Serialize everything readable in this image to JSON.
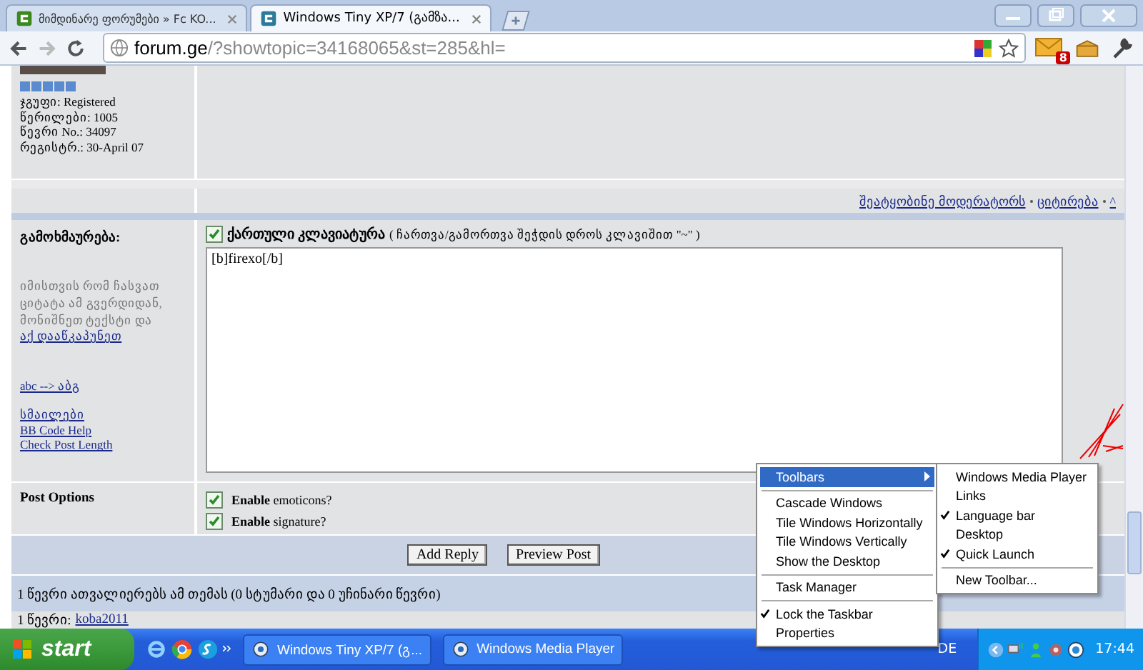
{
  "browser": {
    "tabs": [
      {
        "title": "მიმდინარე ფორუმები » Fc KO...",
        "selected": false
      },
      {
        "title": "Windows Tiny XP/7 (გამზა...",
        "selected": true
      }
    ],
    "address": {
      "host": "forum.ge",
      "path": "/?showtopic=34168065&st=285&hl="
    },
    "mail_count": "8"
  },
  "profile": {
    "lines": [
      "ჯგუფი: Registered",
      "წერილები: 1005",
      "წევრი No.: 34097",
      "რეგისტრ.: 30-April 07"
    ]
  },
  "post_links": [
    "შეატყობინე მოდერატორს",
    "ციტირება",
    "^"
  ],
  "reply": {
    "label": "გამოხმაურება:",
    "hint": "იმისთვის რომ ჩასვათ ციტატა ამ გვერდიდან, მონიშნეთ ტექსტი და",
    "hint_link": "აქ დააწკაპუნეთ",
    "translit_link": "abc --> აბგ",
    "links": [
      "სმაილები",
      "BB Code Help",
      "Check Post Length"
    ],
    "keyboard": {
      "label": "ქართული კლავიატურა",
      "note": "( ჩართვა/გამორთვა შეჭდის დროს კლავიშით \"~\" )",
      "checked": true
    },
    "message": "[b]firexo[/b]"
  },
  "options": {
    "label": "Post Options",
    "items": [
      {
        "bold": "Enable",
        "text": "emoticons?",
        "checked": true
      },
      {
        "bold": "Enable",
        "text": "signature?",
        "checked": true
      }
    ]
  },
  "buttons": [
    "Add Reply",
    "Preview Post"
  ],
  "viewers": "1 წევრი ათვალიერებს ამ თემას (0 სტუმარი და 0 უჩინარი წევრი)",
  "members": {
    "label": "1 წევრი:",
    "link": "koba2011"
  },
  "context_menu": {
    "items": [
      {
        "kind": "submenu",
        "label": "Toolbars",
        "selected": true,
        "checked": false
      },
      {
        "kind": "separator"
      },
      {
        "kind": "item",
        "label": "Cascade Windows",
        "selected": false,
        "checked": false
      },
      {
        "kind": "item",
        "label": "Tile Windows Horizontally",
        "selected": false,
        "checked": false
      },
      {
        "kind": "item",
        "label": "Tile Windows Vertically",
        "selected": false,
        "checked": false
      },
      {
        "kind": "item",
        "label": "Show the Desktop",
        "selected": false,
        "checked": false
      },
      {
        "kind": "separator"
      },
      {
        "kind": "item",
        "label": "Task Manager",
        "selected": false,
        "checked": false
      },
      {
        "kind": "separator"
      },
      {
        "kind": "item",
        "label": "Lock the Taskbar",
        "selected": false,
        "checked": true
      },
      {
        "kind": "item",
        "label": "Properties",
        "selected": false,
        "checked": false
      }
    ],
    "submenu": [
      {
        "kind": "item",
        "label": "Windows Media Player",
        "checked": false
      },
      {
        "kind": "item",
        "label": "Links",
        "checked": false
      },
      {
        "kind": "item",
        "label": "Language bar",
        "checked": true
      },
      {
        "kind": "item",
        "label": "Desktop",
        "checked": false
      },
      {
        "kind": "item",
        "label": "Quick Launch",
        "checked": true
      },
      {
        "kind": "separator"
      },
      {
        "kind": "item",
        "label": "New Toolbar...",
        "checked": false
      }
    ]
  },
  "taskbar": {
    "start": "start",
    "windows": [
      {
        "title": "Windows Tiny XP/7 (გ...",
        "selected": false
      },
      {
        "title": "Windows Media Player",
        "selected": false
      }
    ],
    "language": "DE",
    "time": "17:44"
  }
}
